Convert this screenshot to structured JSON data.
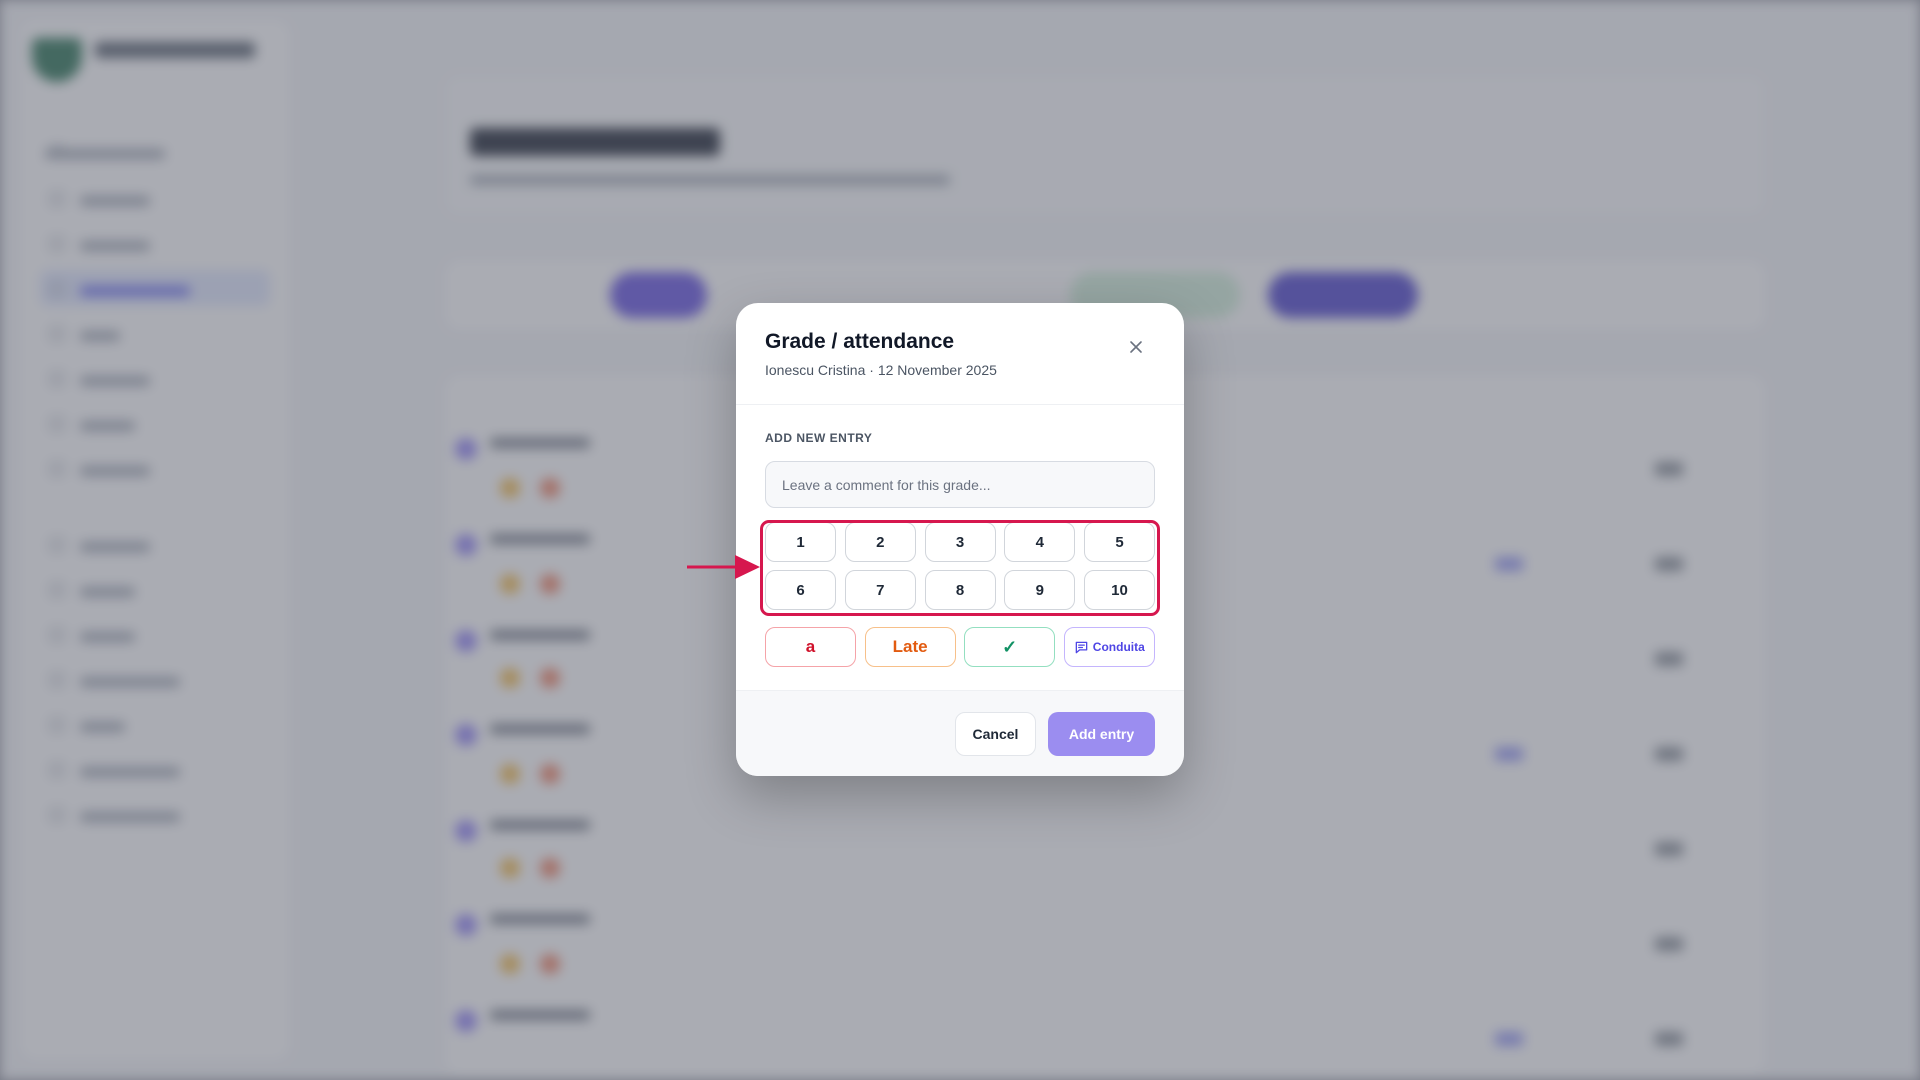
{
  "modal": {
    "title": "Grade / attendance",
    "subtitle": "Ionescu Cristina · 12 November 2025",
    "close_icon": "close-icon",
    "section_label": "ADD NEW ENTRY",
    "comment_placeholder": "Leave a comment for this grade...",
    "grades": [
      "1",
      "2",
      "3",
      "4",
      "5",
      "6",
      "7",
      "8",
      "9",
      "10"
    ],
    "statuses": {
      "absent": "a",
      "late": "Late",
      "present": "✓",
      "conduct": "Conduita",
      "conduct_icon": "message-square-icon"
    },
    "footer": {
      "cancel_label": "Cancel",
      "add_label": "Add entry"
    }
  },
  "annotation": {
    "highlight_color": "#d6174e",
    "arrow_icon": "arrow-right-icon"
  }
}
